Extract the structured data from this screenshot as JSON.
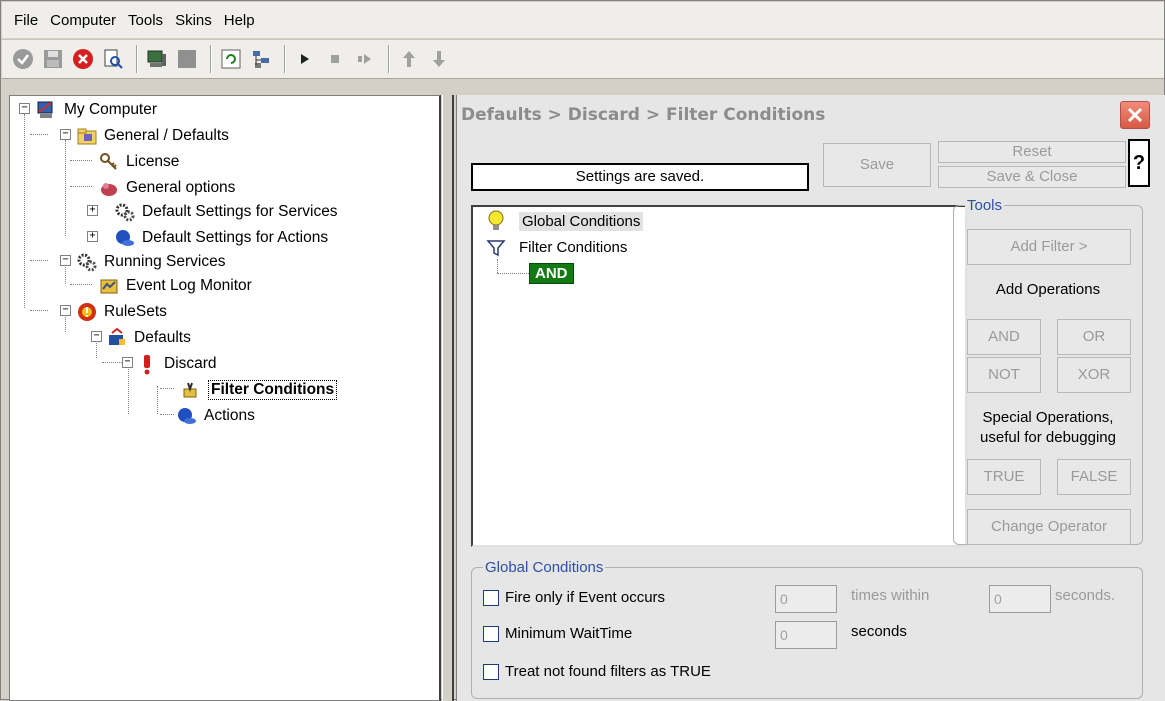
{
  "menu": {
    "items": [
      "File",
      "Computer",
      "Tools",
      "Skins",
      "Help"
    ]
  },
  "tree": {
    "my_computer": "My Computer",
    "general_defaults": "General / Defaults",
    "license": "License",
    "general_options": "General options",
    "default_services": "Default Settings for Services",
    "default_actions": "Default Settings for Actions",
    "running_services": "Running Services",
    "event_log_monitor": "Event Log Monitor",
    "rulesets": "RuleSets",
    "defaults": "Defaults",
    "discard": "Discard",
    "filter_conditions": "Filter Conditions",
    "actions": "Actions"
  },
  "panel": {
    "title": "Defaults > Discard > Filter Conditions",
    "status": "Settings are saved.",
    "save": "Save",
    "reset": "Reset",
    "save_close": "Save & Close",
    "help": "?"
  },
  "conditions": {
    "global": "Global Conditions",
    "filter": "Filter Conditions",
    "and": "AND"
  },
  "tools": {
    "label": "Tools",
    "add_filter": "Add Filter >",
    "add_operations": "Add Operations",
    "and": "AND",
    "or": "OR",
    "not": "NOT",
    "xor": "XOR",
    "special_line1": "Special Operations,",
    "special_line2": "useful for debugging",
    "true": "TRUE",
    "false": "FALSE",
    "change_operator": "Change Operator"
  },
  "global_conditions": {
    "label": "Global Conditions",
    "fire_only": "Fire only if Event occurs",
    "count_value": "0",
    "times_within": "times within",
    "seconds_value": "0",
    "seconds": "seconds.",
    "min_wait": "Minimum WaitTime",
    "wait_value": "0",
    "wait_seconds": "seconds",
    "treat_not_found": "Treat not found filters as TRUE"
  }
}
